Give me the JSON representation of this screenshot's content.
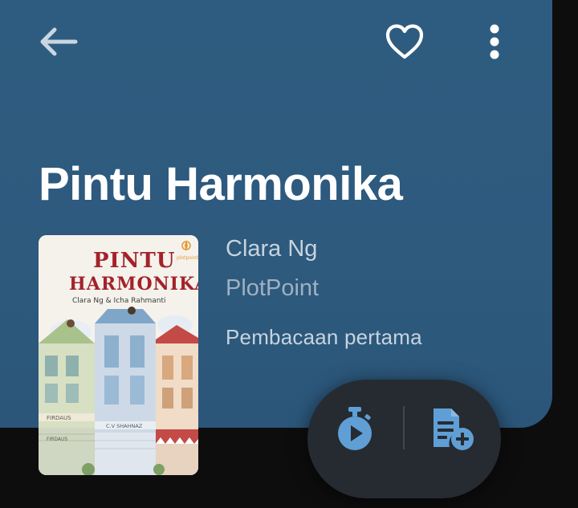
{
  "header": {
    "back_icon": "arrow-left-icon",
    "favorite_icon": "heart-outline-icon",
    "more_icon": "more-vertical-icon"
  },
  "book": {
    "title": "Pintu Harmonika",
    "author": "Clara Ng",
    "publisher": "PlotPoint",
    "reading_status": "Pembacaan pertama",
    "cover": {
      "title_line1": "PINTU",
      "title_line2": "HARMONIKA",
      "authors": "Clara Ng & Icha Rahmanti",
      "publisher_logo": "plotpoint",
      "shop_sign_left": "FIRDAUS",
      "shop_sign_left_lower": "FIRDAUS",
      "shop_sign_center": "C.V SHAHNAZ"
    }
  },
  "actions": {
    "timer_icon": "stopwatch-play-icon",
    "add_to_list_icon": "note-add-icon"
  },
  "colors": {
    "header_bg": "#2e5c80",
    "accent": "#5f9fd6",
    "fab_bg": "#262b31",
    "page_bg": "#0d0d0e"
  }
}
